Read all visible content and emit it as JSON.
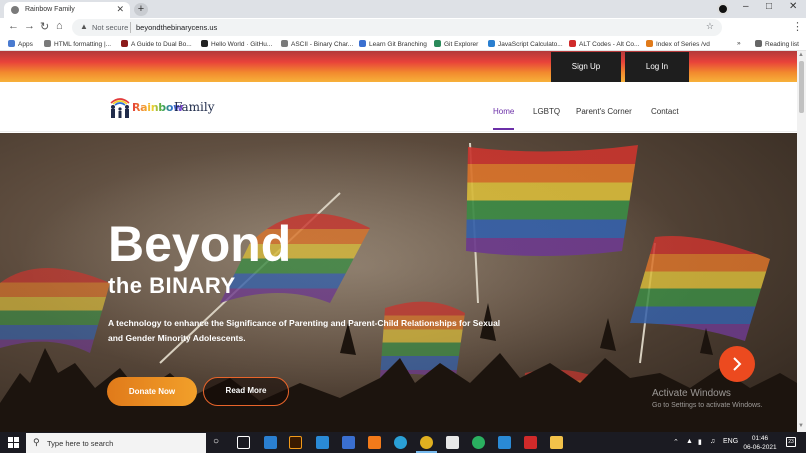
{
  "browser": {
    "tab_title": "Rainbow Family",
    "tab_close": "✕",
    "new_tab": "+",
    "security_label": "Not secure",
    "url": "beyondthebinarycens.us",
    "bookmarks": [
      {
        "label": "Apps",
        "color": "#4a7bd0"
      },
      {
        "label": "HTML formatting  |...",
        "color": "#7a7a7a"
      },
      {
        "label": "A Guide to Dual Bo...",
        "color": "#8b1a1a"
      },
      {
        "label": "Hello World · GitHu...",
        "color": "#222222"
      },
      {
        "label": "ASCII - Binary Char...",
        "color": "#7a7a7a"
      },
      {
        "label": "Learn Git Branching",
        "color": "#3a6fd0"
      },
      {
        "label": "Git Explorer",
        "color": "#2a8a5a"
      },
      {
        "label": "JavaScript Calculato...",
        "color": "#2a7fd0"
      },
      {
        "label": "ALT Codes - Alt Co...",
        "color": "#d02a2a"
      },
      {
        "label": "Index of Series /vd",
        "color": "#e07a1a"
      }
    ],
    "bookmarks_more": "»",
    "reading_list": "Reading list"
  },
  "site": {
    "auth": {
      "signup": "Sign Up",
      "login": "Log In"
    },
    "logo": {
      "rainbow": "Rainbow",
      "family": "Family"
    },
    "nav": [
      {
        "label": "Home",
        "active": true
      },
      {
        "label": "LGBTQ",
        "active": false
      },
      {
        "label": "Parent's Corner",
        "active": false
      },
      {
        "label": "Contact",
        "active": false
      }
    ],
    "hero": {
      "title": "Beyond",
      "subtitle": "the BINARY",
      "text": "A technology to enhance the Significance of Parenting and Parent-Child Relationships for Sexual and Gender Minority Adolescents.",
      "donate": "Donate Now",
      "read_more": "Read More",
      "next_icon": "chevron-right-icon"
    },
    "watermark": {
      "line1": "Activate Windows",
      "line2": "Go to Settings to activate Windows."
    }
  },
  "taskbar": {
    "search_placeholder": "Type here to search",
    "language": "ENG",
    "time": "01:46",
    "date": "06-06-2021",
    "notifications": "23",
    "app_icons": [
      {
        "name": "task-view-icon",
        "color": "#1b1b22"
      },
      {
        "name": "mail-icon",
        "color": "#2a7fd0"
      },
      {
        "name": "illustrator-icon",
        "color": "#f29a1a"
      },
      {
        "name": "vscode-icon",
        "color": "#2a8ad6"
      },
      {
        "name": "calculator-icon",
        "color": "#3a6fd0"
      },
      {
        "name": "sublime-icon",
        "color": "#f27a1a"
      },
      {
        "name": "edge-icon",
        "color": "#2aa0d6"
      },
      {
        "name": "chrome-icon",
        "color": "#e0b020"
      },
      {
        "name": "store-icon",
        "color": "#e8e8e8"
      },
      {
        "name": "whatsapp-icon",
        "color": "#2ab060"
      },
      {
        "name": "vscode-icon",
        "color": "#2a8ad6"
      },
      {
        "name": "acrobat-icon",
        "color": "#d02a2a"
      },
      {
        "name": "file-explorer-icon",
        "color": "#f2c24a"
      }
    ]
  }
}
